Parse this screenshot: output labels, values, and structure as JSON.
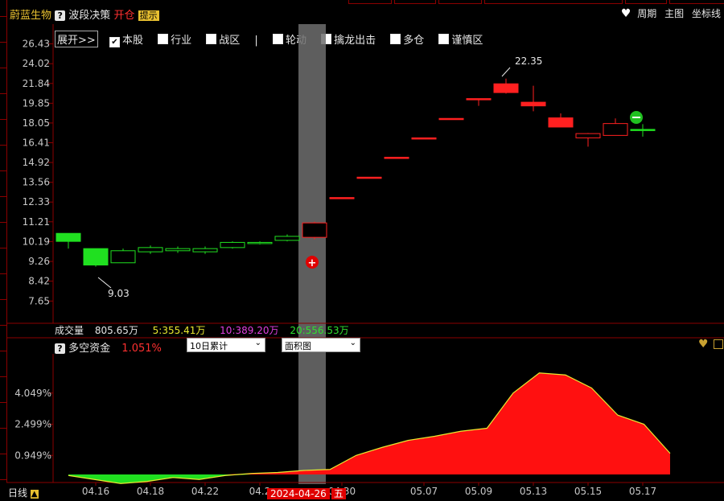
{
  "header": {
    "stock_name": "蔚蓝生物",
    "strategy": "波段决策",
    "signal": "开仓",
    "hint": "提示",
    "right_period": "周期",
    "right_main": "主图",
    "right_axis": "坐标线"
  },
  "toolbar": {
    "expand": "展开>>",
    "items": [
      {
        "label": "本股",
        "checked": true
      },
      {
        "label": "行业",
        "checked": false
      },
      {
        "label": "战区",
        "checked": false
      },
      {
        "label": "轮动",
        "checked": false
      },
      {
        "label": "擒龙出击",
        "checked": false
      },
      {
        "label": "多仓",
        "checked": false
      },
      {
        "label": "谨慎区",
        "checked": false
      }
    ],
    "separator": "|"
  },
  "volume": {
    "label": "成交量",
    "value": "805.65万",
    "ma5": "5:355.41万",
    "ma10": "10:389.20万",
    "ma20": "20:556.53万"
  },
  "sub_panel": {
    "title": "多空资金",
    "value": "1.051%",
    "dropdown1": "10日累计",
    "dropdown2": "面积图"
  },
  "footer": {
    "period": "日线",
    "selected_date": "2024-04-26",
    "weekday": "五"
  },
  "chart_data": [
    {
      "type": "candlestick",
      "ylim": [
        7.2,
        26.9
      ],
      "y_ticks": [
        "26.43",
        "24.02",
        "21.84",
        "19.85",
        "18.05",
        "16.41",
        "14.92",
        "13.56",
        "12.33",
        "11.21",
        "10.19",
        "9.26",
        "8.42",
        "7.65"
      ],
      "annotations": [
        {
          "text": "22.35"
        },
        {
          "text": "9.03"
        }
      ],
      "candles": [
        {
          "o": 10.2,
          "h": 10.6,
          "l": 9.85,
          "c": 10.6,
          "color": "green"
        },
        {
          "o": 9.85,
          "h": 9.85,
          "l": 9.03,
          "c": 9.1,
          "color": "green"
        },
        {
          "o": 9.2,
          "h": 9.85,
          "l": 9.2,
          "c": 9.75,
          "color": "green-hollow"
        },
        {
          "o": 9.7,
          "h": 10.0,
          "l": 9.6,
          "c": 9.9,
          "color": "green-hollow"
        },
        {
          "o": 9.75,
          "h": 9.95,
          "l": 9.65,
          "c": 9.85,
          "color": "green-hollow"
        },
        {
          "o": 9.7,
          "h": 9.95,
          "l": 9.6,
          "c": 9.85,
          "color": "green-hollow"
        },
        {
          "o": 9.9,
          "h": 10.2,
          "l": 9.85,
          "c": 10.15,
          "color": "green-hollow"
        },
        {
          "o": 10.1,
          "h": 10.2,
          "l": 10.05,
          "c": 10.15,
          "color": "green-hollow"
        },
        {
          "o": 10.25,
          "h": 10.55,
          "l": 10.2,
          "c": 10.45,
          "color": "green-hollow"
        },
        {
          "o": 10.4,
          "h": 11.21,
          "l": 10.3,
          "c": 11.15,
          "color": "red-hollow"
        },
        {
          "o": 12.6,
          "h": 12.6,
          "l": 12.6,
          "c": 12.6,
          "color": "red"
        },
        {
          "o": 13.9,
          "h": 13.9,
          "l": 13.9,
          "c": 13.9,
          "color": "red"
        },
        {
          "o": 15.3,
          "h": 15.3,
          "l": 15.3,
          "c": 15.3,
          "color": "red"
        },
        {
          "o": 16.8,
          "h": 16.8,
          "l": 16.8,
          "c": 16.8,
          "color": "red"
        },
        {
          "o": 18.45,
          "h": 18.45,
          "l": 18.45,
          "c": 18.45,
          "color": "red"
        },
        {
          "o": 20.3,
          "h": 20.3,
          "l": 19.6,
          "c": 20.3,
          "color": "red"
        },
        {
          "o": 20.9,
          "h": 22.35,
          "l": 20.8,
          "c": 21.8,
          "color": "red"
        },
        {
          "o": 19.6,
          "h": 21.6,
          "l": 19.1,
          "c": 19.95,
          "color": "red"
        },
        {
          "o": 18.5,
          "h": 18.9,
          "l": 17.7,
          "c": 17.7,
          "color": "red"
        },
        {
          "o": 16.8,
          "h": 17.2,
          "l": 16.1,
          "c": 17.15,
          "color": "red-hollow"
        },
        {
          "o": 17.0,
          "h": 18.45,
          "l": 17.0,
          "c": 18.0,
          "color": "red-hollow"
        },
        {
          "o": 17.5,
          "h": 17.95,
          "l": 16.9,
          "c": 17.5,
          "color": "green"
        }
      ]
    },
    {
      "type": "area",
      "ylim": [
        -0.4,
        5.6
      ],
      "y_ticks": [
        "4.049%",
        "2.499%",
        "0.949%"
      ],
      "x_labels": [
        "04.16",
        "04.18",
        "04.22",
        "04.2",
        "04.30",
        "05.07",
        "05.09",
        "05.13",
        "05.15",
        "05.17"
      ],
      "values": [
        -0.05,
        -0.25,
        -0.45,
        -0.35,
        -0.15,
        -0.25,
        -0.05,
        0.05,
        0.1,
        0.2,
        0.25,
        0.95,
        1.35,
        1.7,
        1.9,
        2.15,
        2.3,
        4.05,
        5.05,
        4.95,
        4.3,
        2.95,
        2.5,
        1.05
      ]
    }
  ]
}
